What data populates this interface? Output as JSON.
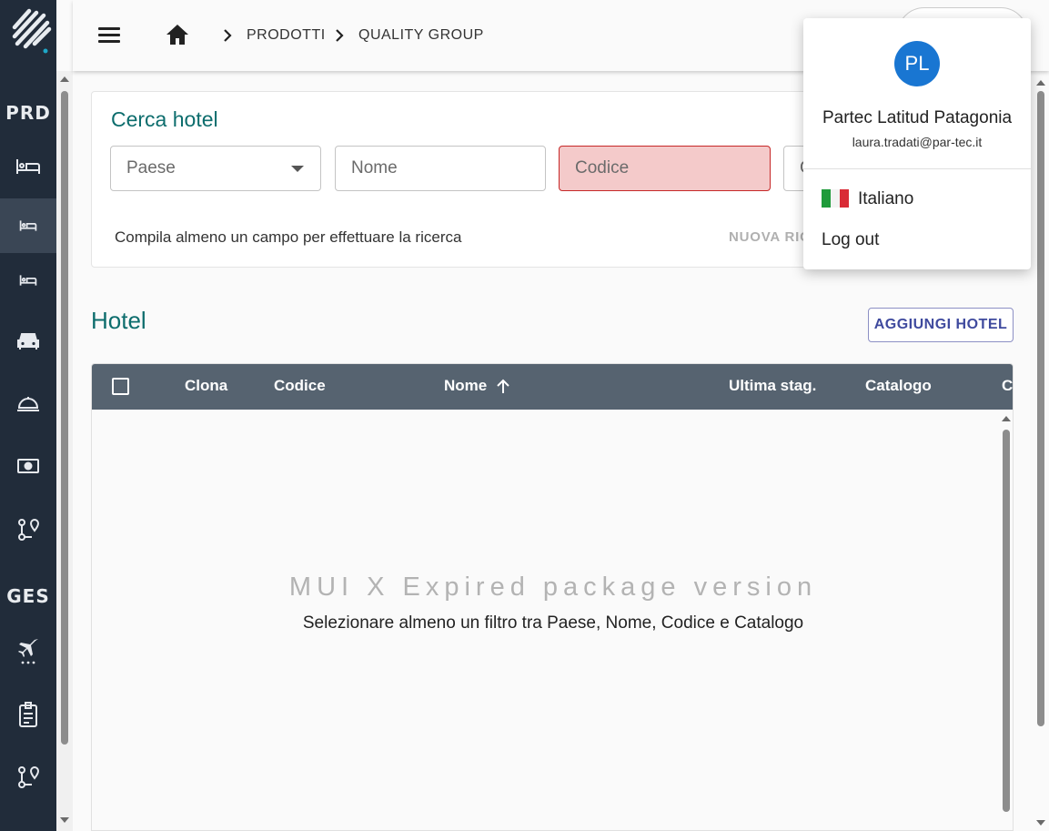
{
  "sidebar": {
    "sections": [
      {
        "label": "PRD"
      },
      {
        "label": "GES"
      }
    ],
    "icons": [
      "bed-icon",
      "bed-small-icon",
      "bed-small-icon",
      "car-icon",
      "room-service-icon",
      "money-icon",
      "route-icon",
      "flight-icon",
      "badge-icon",
      "route-icon"
    ]
  },
  "header": {
    "breadcrumb": [
      "PRODOTTI",
      "QUALITY GROUP"
    ]
  },
  "search": {
    "title": "Cerca hotel",
    "fields": {
      "paese": "Paese",
      "nome": "Nome",
      "codice": "Codice",
      "catalogo_partial": "C"
    },
    "hint": "Compila almeno un campo per effettuare la ricerca",
    "new_search_label": "NUOVA RIC"
  },
  "hotels": {
    "title": "Hotel",
    "add_button": "AGGIUNGI HOTEL",
    "columns": [
      "Clona",
      "Codice",
      "Nome",
      "Ultima stag.",
      "Catalogo",
      "C"
    ],
    "sort_icon": "arrow-up-icon",
    "watermark": "MUI X Expired package version",
    "empty_message": "Selezionare almeno un filtro tra Paese, Nome, Codice e Catalogo"
  },
  "user_menu": {
    "initials": "PL",
    "name": "Partec Latitud Patagonia",
    "email": "laura.tradati@par-tec.it",
    "language": "Italiano",
    "logout": "Log out"
  },
  "colors": {
    "sidebar_bg": "#212c3a",
    "accent_teal": "#0d6d6d",
    "avatar_blue": "#1976d2",
    "grid_header": "#566370",
    "error_field": "#f4caca"
  }
}
